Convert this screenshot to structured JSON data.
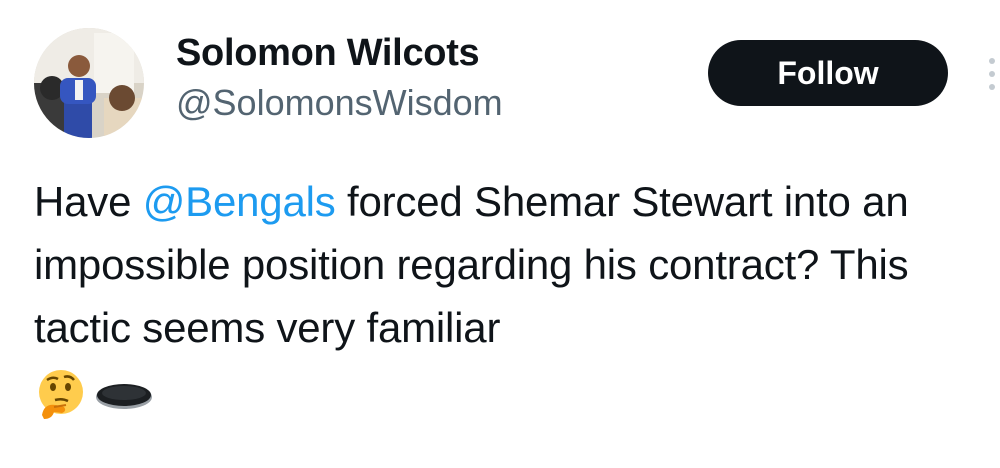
{
  "author": {
    "display_name": "Solomon Wilcots",
    "handle": "@SolomonsWisdom"
  },
  "follow_label": "Follow",
  "tweet": {
    "text_before": "Have ",
    "mention": "@Bengals",
    "text_after": " forced Shemar Stewart into an impossible position regarding his contract? This tactic seems very familiar ",
    "emojis": [
      "thinking-face-icon",
      "hole-icon"
    ]
  },
  "colors": {
    "text": "#0f1419",
    "secondary": "#536471",
    "link": "#1d9bf0",
    "button_bg": "#0f1419"
  }
}
